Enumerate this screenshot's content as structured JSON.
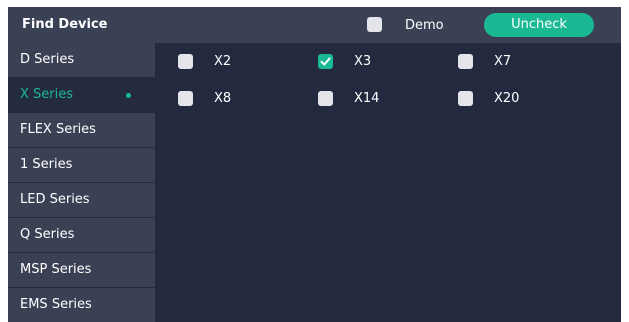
{
  "header": {
    "title": "Find Device",
    "demo_label": "Demo",
    "demo_checked": false,
    "uncheck_button_label": "Uncheck"
  },
  "sidebar": {
    "items": [
      {
        "label": "D Series",
        "active": false
      },
      {
        "label": "X Series",
        "active": true
      },
      {
        "label": "FLEX Series",
        "active": false
      },
      {
        "label": "1 Series",
        "active": false
      },
      {
        "label": "LED Series",
        "active": false
      },
      {
        "label": "Q Series",
        "active": false
      },
      {
        "label": "MSP Series",
        "active": false
      },
      {
        "label": "EMS Series",
        "active": false
      }
    ]
  },
  "devices": [
    {
      "label": "X2",
      "checked": false
    },
    {
      "label": "X3",
      "checked": true
    },
    {
      "label": "X7",
      "checked": false
    },
    {
      "label": "X8",
      "checked": false
    },
    {
      "label": "X14",
      "checked": false
    },
    {
      "label": "X20",
      "checked": false
    }
  ],
  "colors": {
    "accent": "#1bb894",
    "panel_background": "#232a40",
    "header_background": "#3b4155",
    "checkbox_unchecked": "#e3e5ea"
  },
  "icons": {
    "checkmark": "check-icon",
    "active_indicator": "active-dot-icon"
  }
}
